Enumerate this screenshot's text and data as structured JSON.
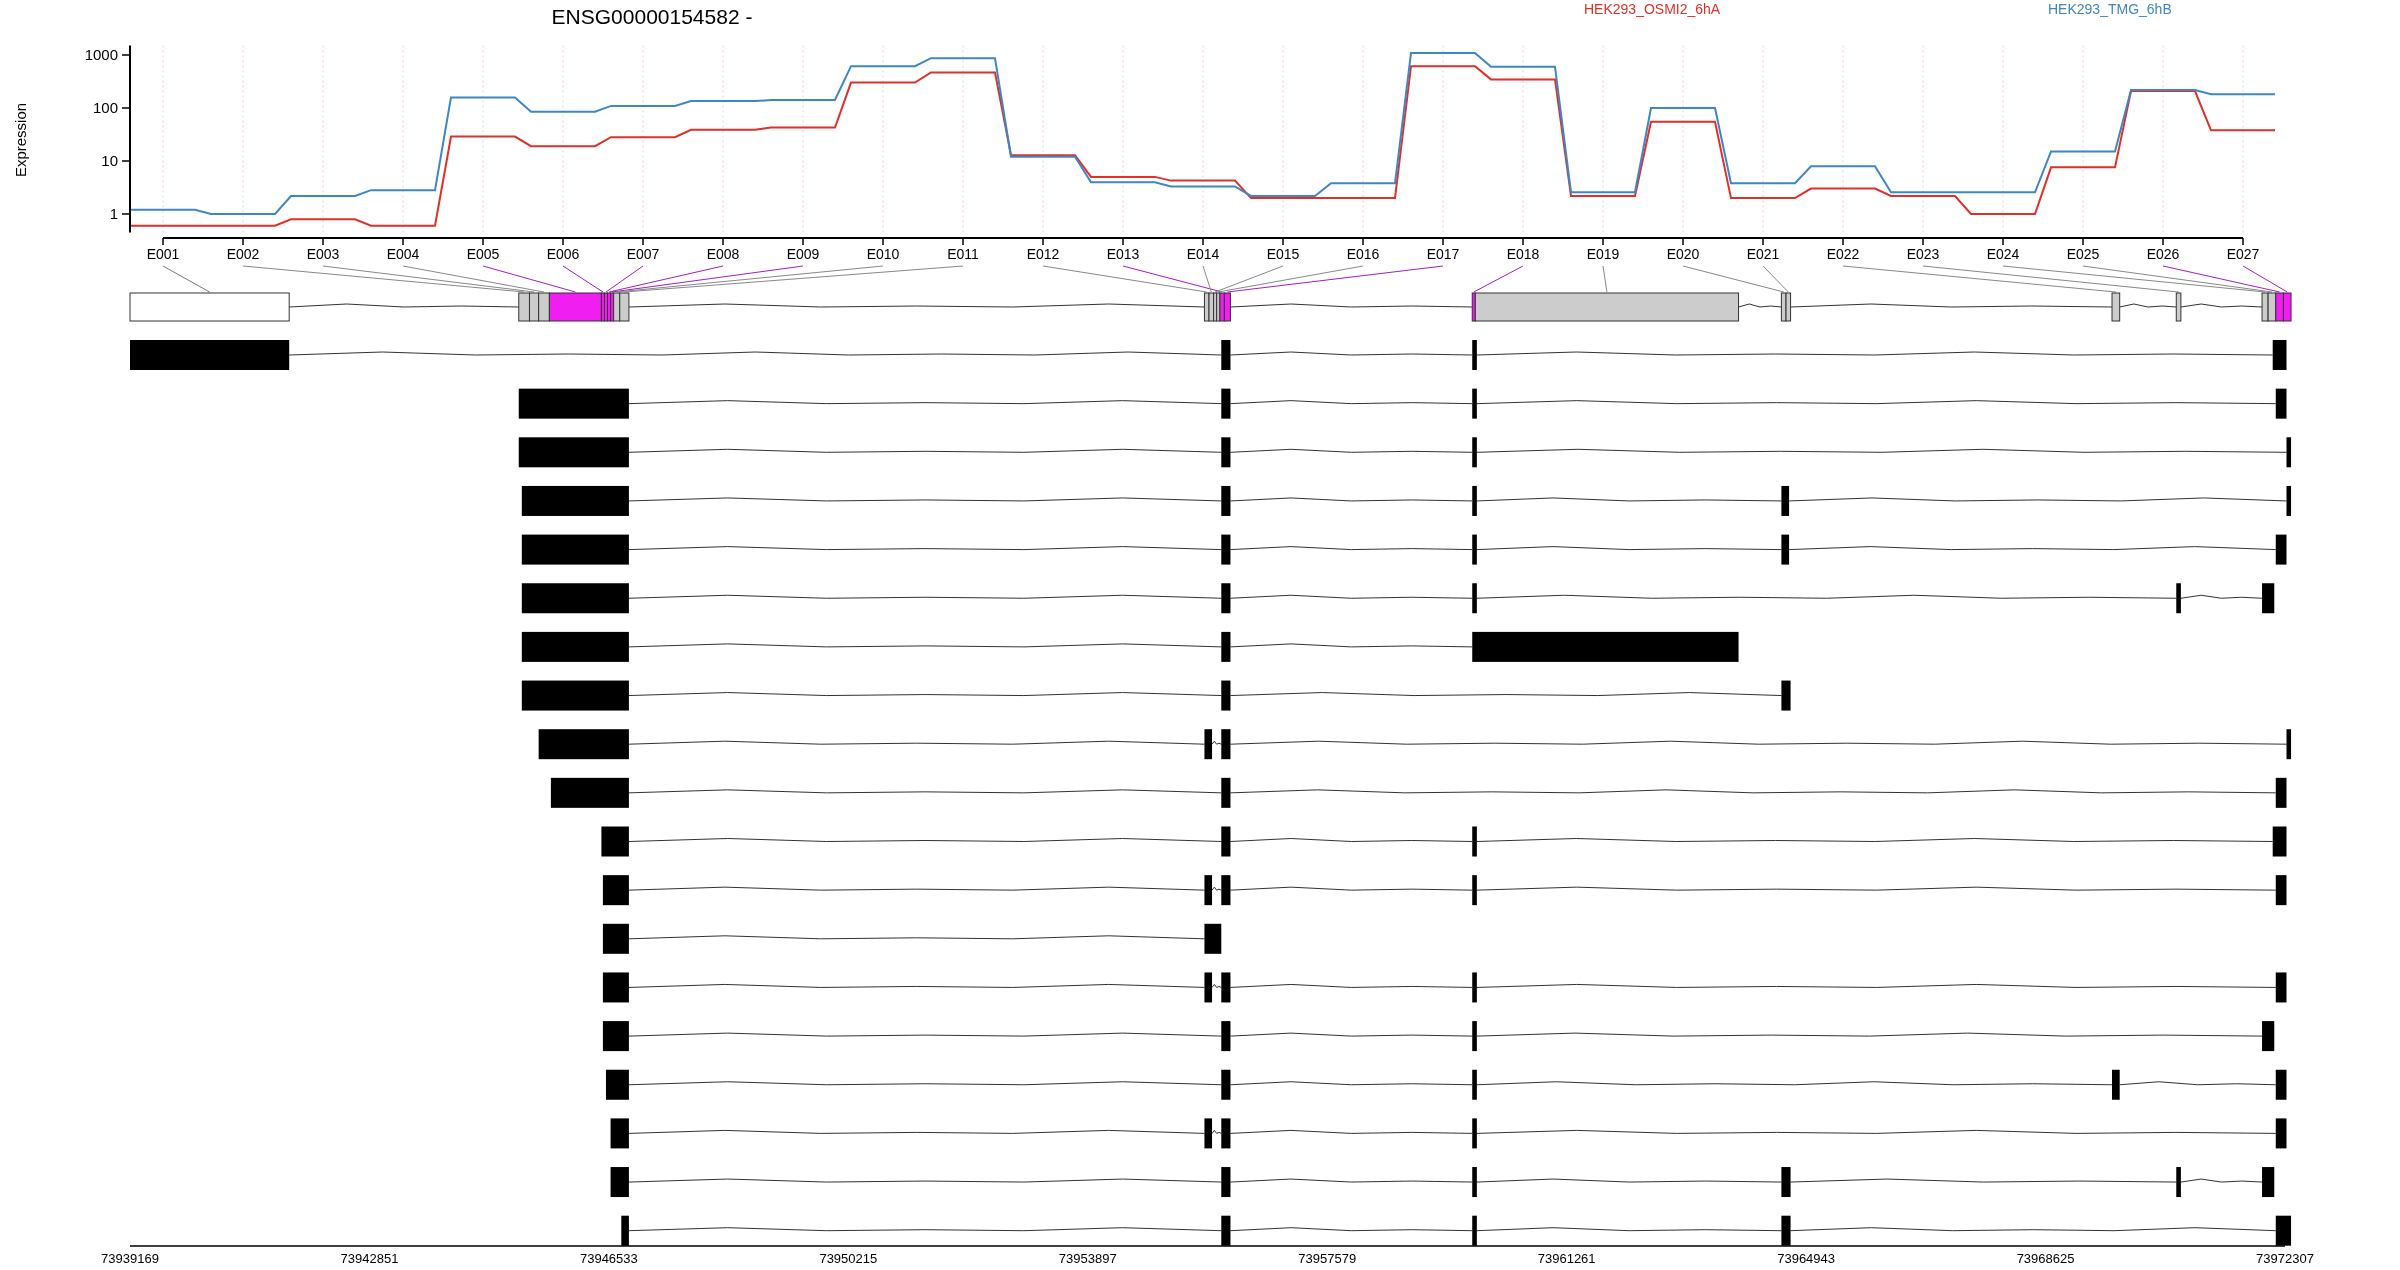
{
  "plot": {
    "expression_plot": {
      "title": "ENSG00000154582 -",
      "ylabel": "Expression",
      "categories": [
        "E001",
        "E002",
        "E003",
        "E004",
        "E005",
        "E006",
        "E007",
        "E008",
        "E009",
        "E010",
        "E011",
        "E012",
        "E013",
        "E014",
        "E015",
        "E016",
        "E017",
        "E018",
        "E019",
        "E020",
        "E021",
        "E022",
        "E023",
        "E024",
        "E025",
        "E026",
        "E027"
      ],
      "yticks": [
        "1000",
        "100",
        "10",
        "1"
      ],
      "legend": [
        {
          "name": "HEK293_OSMI2_6hA",
          "color": "#e0302a"
        },
        {
          "name": "HEK293_TMG_6hB",
          "color": "#3f86c4"
        }
      ]
    },
    "gene_model": {
      "exons": [
        {
          "kind": "untested"
        },
        {
          "kind": "tested"
        },
        {
          "kind": "tested"
        },
        {
          "kind": "tested"
        },
        {
          "kind": "significant"
        },
        {
          "kind": "significant"
        },
        {
          "kind": "significant"
        },
        {
          "kind": "significant"
        },
        {
          "kind": "significant"
        },
        {
          "kind": "tested"
        },
        {
          "kind": "tested"
        },
        {
          "kind": "tested"
        },
        {
          "kind": "significant"
        },
        {
          "kind": "tested"
        },
        {
          "kind": "tested"
        },
        {
          "kind": "tested"
        },
        {
          "kind": "significant"
        },
        {
          "kind": "significant"
        },
        {
          "kind": "tested"
        },
        {
          "kind": "tested"
        },
        {
          "kind": "tested"
        },
        {
          "kind": "tested"
        },
        {
          "kind": "tested"
        },
        {
          "kind": "tested"
        },
        {
          "kind": "tested"
        },
        {
          "kind": "significant"
        },
        {
          "kind": "significant"
        }
      ]
    },
    "genomic_axis": {
      "ticks": [
        "73939169",
        "73942851",
        "73946533",
        "73950215",
        "73953897",
        "73957579",
        "73961261",
        "73964943",
        "73968625",
        "73972307"
      ]
    }
  }
}
